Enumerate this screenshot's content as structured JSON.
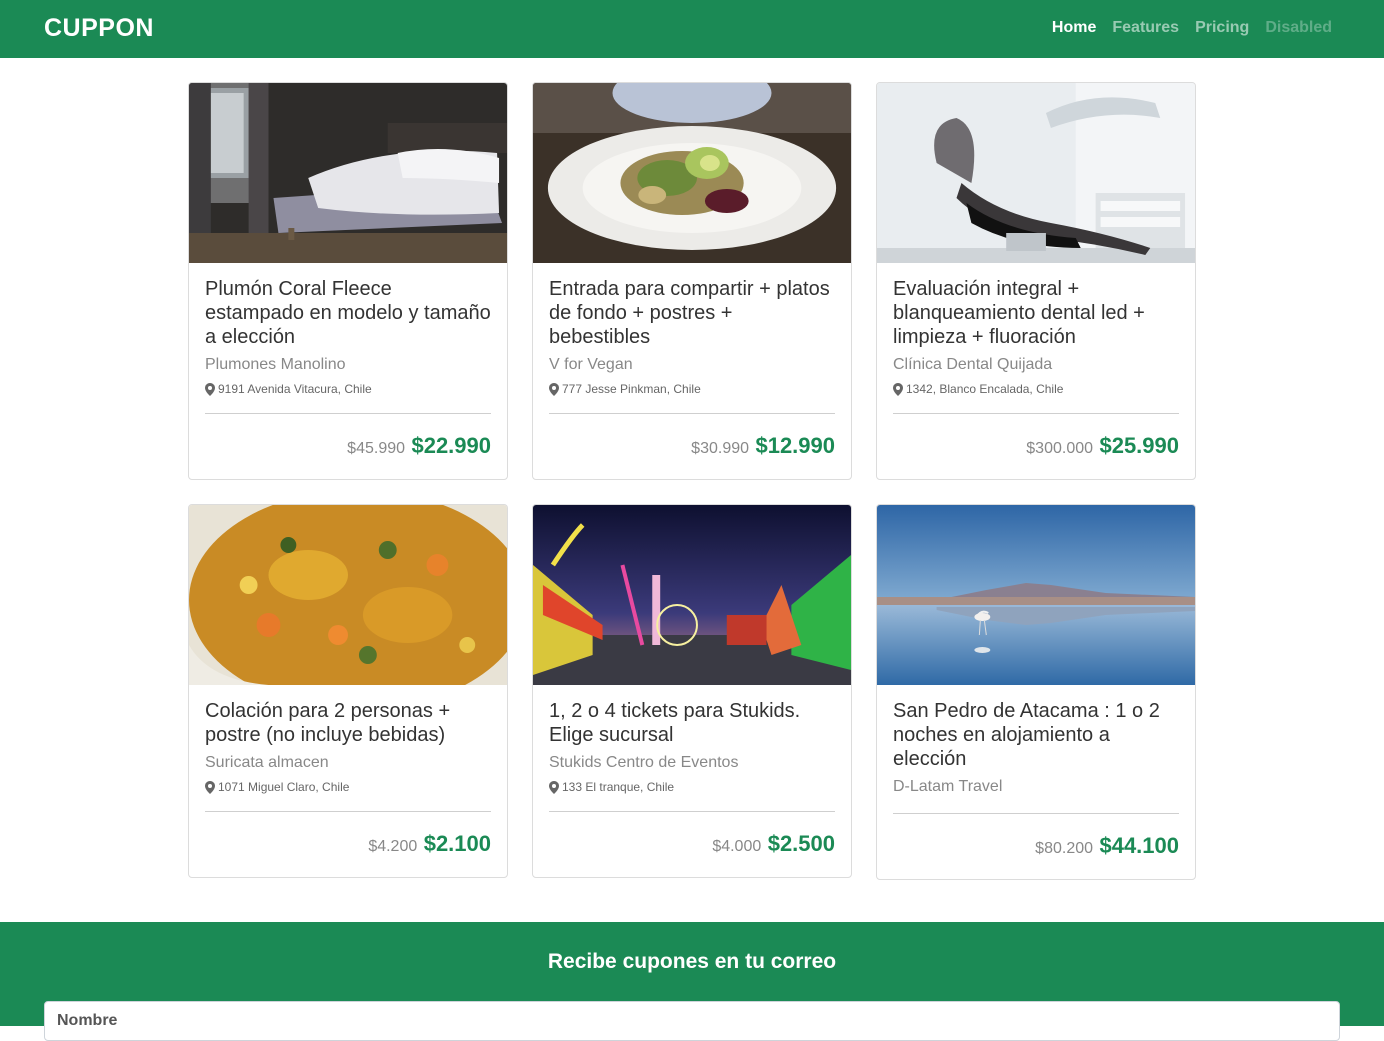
{
  "nav": {
    "brand": "CUPPON",
    "links": [
      {
        "label": "Home"
      },
      {
        "label": "Features"
      },
      {
        "label": "Pricing"
      },
      {
        "label": "Disabled"
      }
    ]
  },
  "cards": [
    {
      "title": "Plumón Coral Fleece estampado en modelo y tamaño a elección",
      "merchant": "Plumones Manolino",
      "address": "9191 Avenida Vitacura, Chile",
      "old_price": "$45.990",
      "new_price": "$22.990"
    },
    {
      "title": "Entrada para compartir + platos de fondo + postres + bebestibles",
      "merchant": "V for Vegan",
      "address": "777 Jesse Pinkman, Chile",
      "old_price": "$30.990",
      "new_price": "$12.990"
    },
    {
      "title": "Evaluación integral + blanqueamiento dental led + limpieza + fluoración",
      "merchant": "Clínica Dental Quijada",
      "address": "1342, Blanco Encalada, Chile",
      "old_price": "$300.000",
      "new_price": "$25.990"
    },
    {
      "title": "Colación para 2 personas + postre (no incluye bebidas)",
      "merchant": "Suricata almacen",
      "address": "1071 Miguel Claro, Chile",
      "old_price": "$4.200",
      "new_price": "$2.100"
    },
    {
      "title": "1, 2 o 4 tickets para Stukids. Elige sucursal",
      "merchant": "Stukids Centro de Eventos",
      "address": "133 El tranque, Chile",
      "old_price": "$4.000",
      "new_price": "$2.500"
    },
    {
      "title": "San Pedro de Atacama : 1 o 2 noches en alojamiento a elección",
      "merchant": "D-Latam Travel",
      "address": "",
      "old_price": "$80.200",
      "new_price": "$44.100"
    }
  ],
  "footer": {
    "title": "Recibe cupones en tu correo",
    "name_placeholder": "Nombre"
  },
  "colors": {
    "brand_green": "#1b8a55"
  }
}
